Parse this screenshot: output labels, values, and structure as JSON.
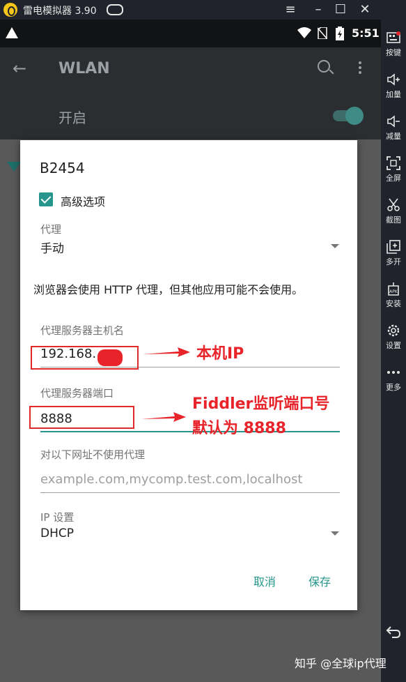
{
  "window": {
    "title": "雷电模拟器 3.90",
    "controls": [
      "menu",
      "minimize",
      "maximize",
      "close"
    ]
  },
  "status_bar": {
    "time": "5:51",
    "icons": [
      "warning-icon",
      "wifi-icon",
      "no-sim-icon",
      "battery-icon"
    ]
  },
  "app_bar": {
    "title": "WLAN",
    "toggle_label": "开启",
    "toggle_on": true
  },
  "dialog": {
    "network_name": "B2454",
    "advanced_options_label": "高级选项",
    "advanced_checked": true,
    "proxy": {
      "caption": "代理",
      "value": "手动"
    },
    "note": "浏览器会使用 HTTP 代理，但其他应用可能不会使用。",
    "hostname": {
      "caption": "代理服务器主机名",
      "value": "192.168."
    },
    "port": {
      "caption": "代理服务器端口",
      "value": "8888"
    },
    "bypass": {
      "caption": "对以下网址不使用代理",
      "placeholder": "example.com,mycomp.test.com,localhost"
    },
    "ip_settings": {
      "caption": "IP 设置",
      "value": "DHCP"
    },
    "cancel_label": "取消",
    "save_label": "保存"
  },
  "annotations": {
    "host_note": "本机IP",
    "port_note_line1": "Fiddler监听端口号",
    "port_note_line2": "默认为 8888"
  },
  "sidebar": {
    "items": [
      {
        "label": "按键",
        "icon": "keyboard-icon"
      },
      {
        "label": "加量",
        "icon": "volume-up-icon"
      },
      {
        "label": "减量",
        "icon": "volume-down-icon"
      },
      {
        "label": "全屏",
        "icon": "fullscreen-icon"
      },
      {
        "label": "截图",
        "icon": "scissors-icon"
      },
      {
        "label": "多开",
        "icon": "multi-instance-icon"
      },
      {
        "label": "安装",
        "icon": "apk-install-icon"
      },
      {
        "label": "设置",
        "icon": "gear-icon"
      },
      {
        "label": "更多",
        "icon": "more-dots-icon"
      }
    ]
  },
  "watermark": "知乎 @全球ip代理",
  "colors": {
    "accent": "#26958c",
    "annotation_red": "#e8242a"
  }
}
